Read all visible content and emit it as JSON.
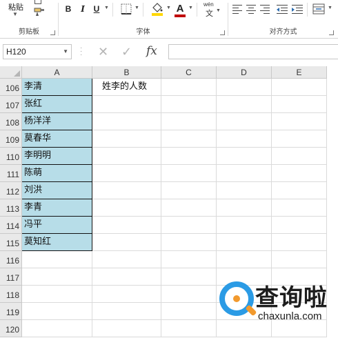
{
  "ribbon": {
    "clipboard": {
      "paste_label": "粘贴",
      "group_label": "剪贴板"
    },
    "font": {
      "bold": "B",
      "italic": "I",
      "underline": "U",
      "font_color_glyph": "A",
      "phonetic_glyph": "wén",
      "group_label": "字体"
    },
    "alignment": {
      "group_label": "对齐方式"
    },
    "colors": {
      "fill_accent": "#ffd700",
      "font_accent": "#c00000"
    }
  },
  "formula_bar": {
    "name_box_value": "H120",
    "cancel_glyph": "✕",
    "enter_glyph": "✓",
    "fx_label": "fx",
    "formula_value": ""
  },
  "sheet": {
    "columns": [
      "A",
      "B",
      "C",
      "D",
      "E"
    ],
    "rows": [
      {
        "num": "106",
        "a": "李清",
        "b": "姓李的人数"
      },
      {
        "num": "107",
        "a": "张红",
        "b": ""
      },
      {
        "num": "108",
        "a": "杨洋洋",
        "b": ""
      },
      {
        "num": "109",
        "a": "莫春华",
        "b": ""
      },
      {
        "num": "110",
        "a": "李明明",
        "b": ""
      },
      {
        "num": "111",
        "a": "陈萌",
        "b": ""
      },
      {
        "num": "112",
        "a": "刘洪",
        "b": ""
      },
      {
        "num": "113",
        "a": "李青",
        "b": ""
      },
      {
        "num": "114",
        "a": "冯平",
        "b": ""
      },
      {
        "num": "115",
        "a": "莫知红",
        "b": ""
      },
      {
        "num": "116",
        "a": "",
        "b": ""
      },
      {
        "num": "117",
        "a": "",
        "b": ""
      },
      {
        "num": "118",
        "a": "",
        "b": ""
      },
      {
        "num": "119",
        "a": "",
        "b": ""
      },
      {
        "num": "120",
        "a": "",
        "b": ""
      }
    ],
    "shaded_fill": "#b7dde8"
  },
  "watermark": {
    "title": "查询啦",
    "url": "chaxunla.com",
    "accent_blue": "#2b9be5",
    "accent_orange": "#f29a2e"
  }
}
